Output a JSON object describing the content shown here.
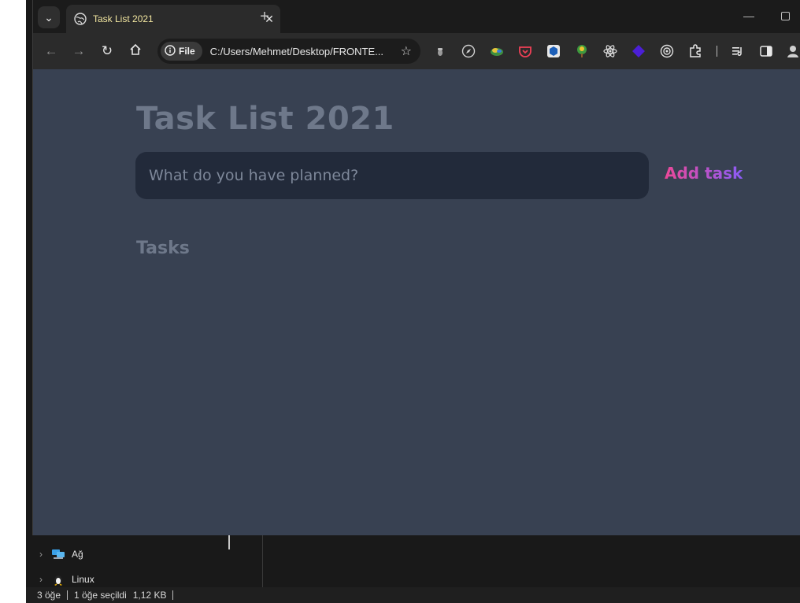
{
  "browser": {
    "tab": {
      "title": "Task List 2021"
    },
    "address_bar": {
      "scheme_chip": "File",
      "url": "C:/Users/Mehmet/Desktop/FRONTE..."
    }
  },
  "app": {
    "title": "Task List 2021",
    "input": {
      "placeholder": "What do you have planned?",
      "value": ""
    },
    "add_button_label": "Add task",
    "tasks_heading": "Tasks",
    "colors": {
      "background": "#384152",
      "input_background": "#222a3a",
      "accent_gradient": [
        "#ec4899",
        "#8b5cf6"
      ],
      "muted_text": "#6e788a"
    }
  },
  "explorer": {
    "tree_items": [
      {
        "label": "Ağ",
        "icon": "network-icon"
      },
      {
        "label": "Linux",
        "icon": "linux-penguin-icon"
      }
    ],
    "status": {
      "item_count": "3 öğe",
      "selection": "1 öğe seçildi",
      "size": "1,12 KB"
    }
  }
}
